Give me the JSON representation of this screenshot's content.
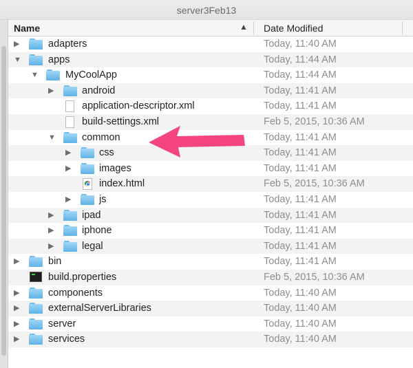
{
  "window": {
    "title": "server3Feb13"
  },
  "columns": {
    "name": "Name",
    "date": "Date Modified",
    "sort_glyph": "▲"
  },
  "accent": {
    "arrow": "#f5457e",
    "folder": "#6bbbe9"
  },
  "rows": [
    {
      "name": "adapters",
      "date": "Today, 11:40 AM",
      "icon": "folder",
      "depth": 0,
      "toggle": "collapsed"
    },
    {
      "name": "apps",
      "date": "Today, 11:44 AM",
      "icon": "folder",
      "depth": 0,
      "toggle": "expanded"
    },
    {
      "name": "MyCoolApp",
      "date": "Today, 11:44 AM",
      "icon": "folder",
      "depth": 1,
      "toggle": "expanded"
    },
    {
      "name": "android",
      "date": "Today, 11:41 AM",
      "icon": "folder",
      "depth": 2,
      "toggle": "collapsed"
    },
    {
      "name": "application-descriptor.xml",
      "date": "Today, 11:41 AM",
      "icon": "file",
      "depth": 2,
      "toggle": "none"
    },
    {
      "name": "build-settings.xml",
      "date": "Feb 5, 2015, 10:36 AM",
      "icon": "file",
      "depth": 2,
      "toggle": "none"
    },
    {
      "name": "common",
      "date": "Today, 11:41 AM",
      "icon": "folder",
      "depth": 2,
      "toggle": "expanded"
    },
    {
      "name": "css",
      "date": "Today, 11:41 AM",
      "icon": "folder",
      "depth": 3,
      "toggle": "collapsed"
    },
    {
      "name": "images",
      "date": "Today, 11:41 AM",
      "icon": "folder",
      "depth": 3,
      "toggle": "collapsed"
    },
    {
      "name": "index.html",
      "date": "Feb 5, 2015, 10:36 AM",
      "icon": "html",
      "depth": 3,
      "toggle": "none"
    },
    {
      "name": "js",
      "date": "Today, 11:41 AM",
      "icon": "folder",
      "depth": 3,
      "toggle": "collapsed"
    },
    {
      "name": "ipad",
      "date": "Today, 11:41 AM",
      "icon": "folder",
      "depth": 2,
      "toggle": "collapsed"
    },
    {
      "name": "iphone",
      "date": "Today, 11:41 AM",
      "icon": "folder",
      "depth": 2,
      "toggle": "collapsed"
    },
    {
      "name": "legal",
      "date": "Today, 11:41 AM",
      "icon": "folder",
      "depth": 2,
      "toggle": "collapsed"
    },
    {
      "name": "bin",
      "date": "Today, 11:41 AM",
      "icon": "folder",
      "depth": 0,
      "toggle": "collapsed"
    },
    {
      "name": "build.properties",
      "date": "Feb 5, 2015, 10:36 AM",
      "icon": "terminal",
      "depth": 0,
      "toggle": "none"
    },
    {
      "name": "components",
      "date": "Today, 11:40 AM",
      "icon": "folder",
      "depth": 0,
      "toggle": "collapsed"
    },
    {
      "name": "externalServerLibraries",
      "date": "Today, 11:40 AM",
      "icon": "folder",
      "depth": 0,
      "toggle": "collapsed"
    },
    {
      "name": "server",
      "date": "Today, 11:40 AM",
      "icon": "folder",
      "depth": 0,
      "toggle": "collapsed"
    },
    {
      "name": "services",
      "date": "Today, 11:40 AM",
      "icon": "folder",
      "depth": 0,
      "toggle": "collapsed"
    }
  ]
}
